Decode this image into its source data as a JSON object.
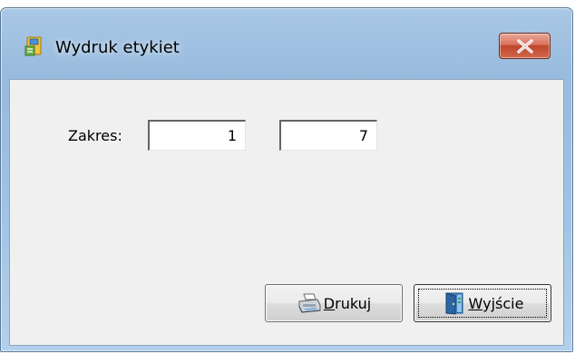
{
  "window": {
    "title": "Wydruk etykiet",
    "icon": "label-print-app-icon",
    "close_icon": "close-icon"
  },
  "form": {
    "range_label": "Zakres:",
    "range_from": "1",
    "range_to": "7"
  },
  "buttons": {
    "print": {
      "mnemonic": "D",
      "rest": "rukuj",
      "icon": "printer-icon"
    },
    "exit": {
      "mnemonic": "W",
      "rest": "yjście",
      "icon": "exit-door-icon"
    }
  },
  "colors": {
    "close_button": "#c0452b",
    "client_background": "#f0f0f0",
    "frame": "#9fc2e3"
  }
}
